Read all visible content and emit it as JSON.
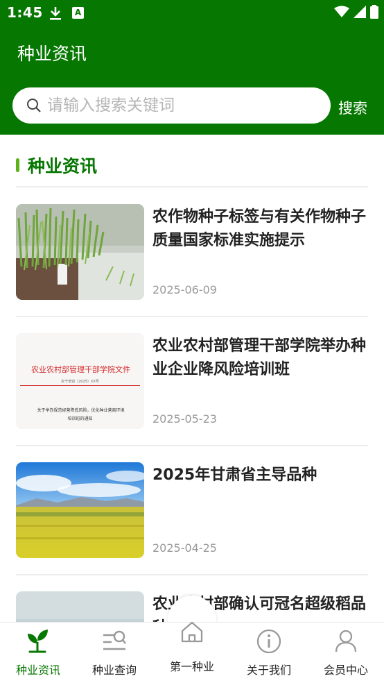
{
  "status": {
    "time": "1:45",
    "a_badge": "A"
  },
  "header": {
    "title": "种业资讯"
  },
  "search": {
    "placeholder": "请输入搜索关键词",
    "button": "搜索"
  },
  "section": {
    "title": "种业资讯"
  },
  "news": [
    {
      "title": "农作物种子标签与有关作物种子质量国家标准实施提示",
      "date": "2025-06-09",
      "image": "seedling-trays"
    },
    {
      "title": "农业农村部管理干部学院举办种业企业降风险培训班",
      "date": "2025-05-23",
      "image": "document-scan",
      "doc_heading": "农业农村部管理干部学院文件",
      "doc_ref": "农干培训〔2025〕XX号",
      "doc_subject_1": "关于举办规范经营降低风险，优化种业营商环境",
      "doc_subject_2": "培训班的通知"
    },
    {
      "title": "2025年甘肃省主导品种",
      "date": "2025-04-25",
      "image": "rapeseed-field"
    },
    {
      "title": "农业农村部确认可冠名超级稻品种和示范",
      "date": "",
      "image": "sky"
    }
  ],
  "nav": [
    {
      "label": "种业资讯",
      "icon": "sprout-icon",
      "active": true
    },
    {
      "label": "种业查询",
      "icon": "list-search-icon",
      "active": false
    },
    {
      "label": "第一种业",
      "icon": "home-icon",
      "active": false
    },
    {
      "label": "关于我们",
      "icon": "info-icon",
      "active": false
    },
    {
      "label": "会员中心",
      "icon": "user-icon",
      "active": false
    }
  ],
  "colors": {
    "primary": "#067700",
    "accent_bar": "#5bb319",
    "date": "#999999"
  }
}
